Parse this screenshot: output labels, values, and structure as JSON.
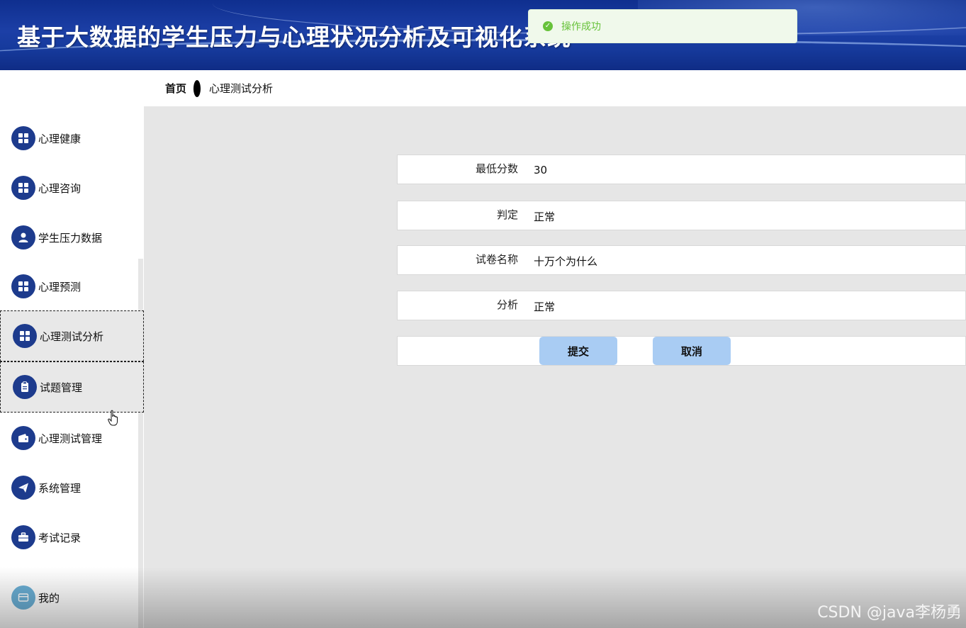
{
  "header": {
    "title": "基于大数据的学生压力与心理状况分析及可视化系统"
  },
  "toast": {
    "message": "操作成功",
    "icon": "check-circle-icon",
    "color": "#67c23a"
  },
  "breadcrumb": {
    "home": "首页",
    "current": "心理测试分析"
  },
  "sidebar": {
    "items": [
      {
        "label": "心理健康",
        "icon": "grid-icon"
      },
      {
        "label": "心理咨询",
        "icon": "grid-icon"
      },
      {
        "label": "学生压力数据",
        "icon": "user-icon"
      },
      {
        "label": "心理预测",
        "icon": "grid-icon"
      },
      {
        "label": "心理测试分析",
        "icon": "grid-icon",
        "active": true
      },
      {
        "label": "试题管理",
        "icon": "clipboard-icon"
      },
      {
        "label": "心理测试管理",
        "icon": "wallet-icon"
      },
      {
        "label": "系统管理",
        "icon": "paper-plane-icon"
      },
      {
        "label": "考试记录",
        "icon": "briefcase-icon"
      }
    ],
    "footer": {
      "label": "我的",
      "icon": "card-icon"
    }
  },
  "form": {
    "fields": [
      {
        "label": "最低分数",
        "value": "30"
      },
      {
        "label": "判定",
        "value": "正常"
      },
      {
        "label": "试卷名称",
        "value": "十万个为什么"
      },
      {
        "label": "分析",
        "value": "正常"
      }
    ],
    "submit_label": "提交",
    "cancel_label": "取消"
  },
  "watermark": "CSDN @java李杨勇",
  "colors": {
    "header": "#1c3fa6",
    "menu_icon_bg": "#1d3b8d",
    "button_bg": "#a9ccf3",
    "main_bg": "#e6e6e6"
  }
}
